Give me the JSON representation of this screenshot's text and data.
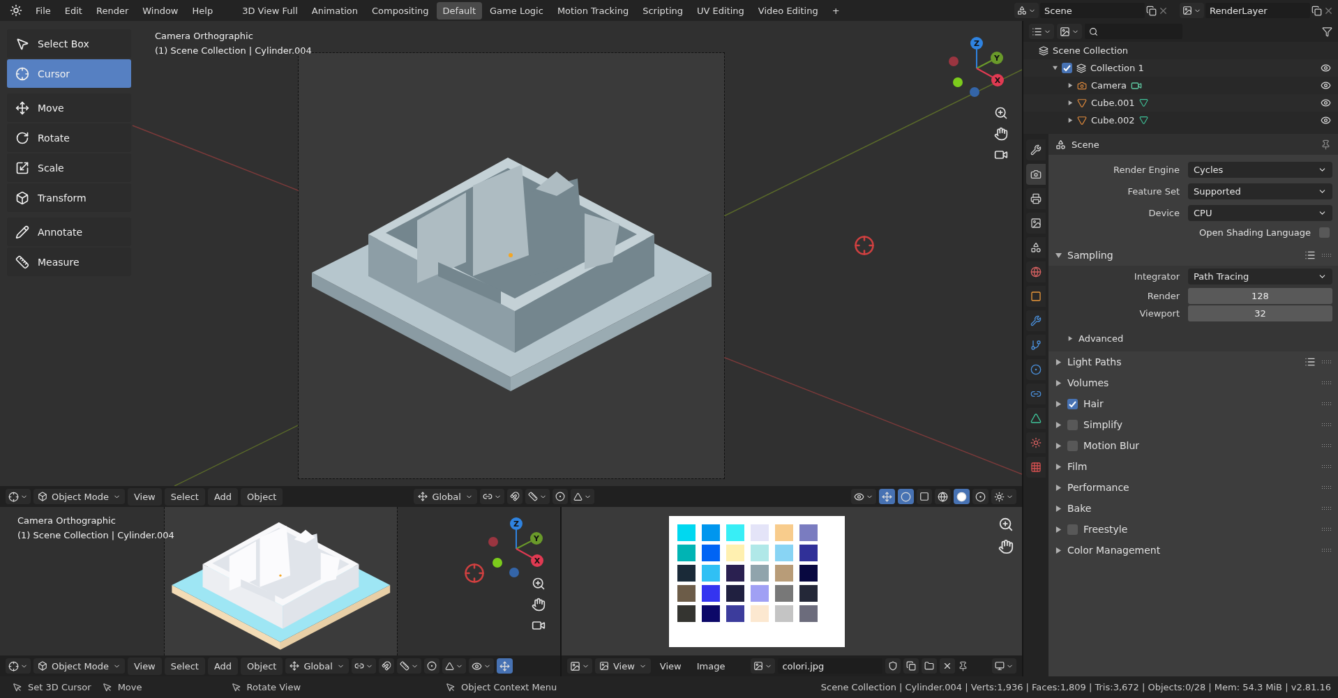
{
  "menu": [
    "File",
    "Edit",
    "Render",
    "Window",
    "Help"
  ],
  "workspaces": [
    {
      "label": "3D View Full",
      "selected": false
    },
    {
      "label": "Animation",
      "selected": false
    },
    {
      "label": "Compositing",
      "selected": false
    },
    {
      "label": "Default",
      "selected": true
    },
    {
      "label": "Game Logic",
      "selected": false
    },
    {
      "label": "Motion Tracking",
      "selected": false
    },
    {
      "label": "Scripting",
      "selected": false
    },
    {
      "label": "UV Editing",
      "selected": false
    },
    {
      "label": "Video Editing",
      "selected": false
    }
  ],
  "add_workspace": "+",
  "scene": "Scene",
  "view_layer": "RenderLayer",
  "main_viewport": {
    "overlay": [
      "Camera Orthographic",
      "(1) Scene Collection | Cylinder.004"
    ],
    "tools": [
      {
        "label": "Select Box",
        "selected": false
      },
      {
        "label": "Cursor",
        "selected": true
      },
      {
        "label": "Move",
        "selected": false
      },
      {
        "label": "Rotate",
        "selected": false
      },
      {
        "label": "Scale",
        "selected": false
      },
      {
        "label": "Transform",
        "selected": false
      },
      {
        "label": "Annotate",
        "selected": false
      },
      {
        "label": "Measure",
        "selected": false
      }
    ],
    "gizmo": [
      "Z",
      "Y",
      "X"
    ],
    "header": {
      "mode": "Object Mode",
      "menus": [
        "View",
        "Select",
        "Add",
        "Object"
      ],
      "orientation": "Global"
    }
  },
  "bottom_viewport": {
    "overlay": [
      "Camera Orthographic",
      "(1) Scene Collection | Cylinder.004"
    ],
    "gizmo": [
      "Z",
      "Y",
      "X"
    ],
    "header": {
      "mode": "Object Mode",
      "menus": [
        "View",
        "Select",
        "Add",
        "Object"
      ],
      "orientation": "Global"
    }
  },
  "image_editor": {
    "view_mode": "View",
    "menus": [
      "View",
      "Image"
    ],
    "image": "colori.jpg"
  },
  "outliner": {
    "root": "Scene Collection",
    "items": [
      {
        "label": "Collection 1",
        "kind": "collection",
        "checked": true,
        "expanded": true,
        "children": [
          {
            "label": "Camera",
            "kind": "camera",
            "expanded": false
          },
          {
            "label": "Cube.001",
            "kind": "mesh",
            "expanded": false
          },
          {
            "label": "Cube.002",
            "kind": "mesh",
            "expanded": false
          }
        ]
      }
    ]
  },
  "properties": {
    "tabs": [
      {
        "selected": false
      },
      {
        "selected": true
      },
      {
        "selected": false
      },
      {
        "selected": false
      },
      {
        "selected": false
      },
      {
        "selected": false
      },
      {
        "selected": false
      },
      {
        "selected": false
      },
      {
        "selected": false
      },
      {
        "selected": false
      },
      {
        "selected": false
      },
      {
        "selected": false
      },
      {
        "selected": false
      },
      {
        "selected": false
      }
    ],
    "title": "Scene",
    "rows": [
      {
        "kind": "dropdown",
        "label": "Render Engine",
        "value": "Cycles"
      },
      {
        "kind": "dropdown",
        "label": "Feature Set",
        "value": "Supported"
      },
      {
        "kind": "dropdown",
        "label": "Device",
        "value": "CPU"
      },
      {
        "kind": "checkbox",
        "label": "Open Shading Language",
        "checked": false
      }
    ],
    "panels": [
      {
        "label": "Sampling",
        "expanded": true,
        "presets": true,
        "rows": [
          {
            "kind": "dropdown",
            "label": "Integrator",
            "value": "Path Tracing"
          },
          {
            "kind": "number",
            "label": "Render",
            "value": "128"
          },
          {
            "kind": "number",
            "label": "Viewport",
            "value": "32"
          }
        ],
        "subpanels": [
          {
            "label": "Advanced",
            "expanded": false
          }
        ]
      },
      {
        "label": "Light Paths",
        "expanded": false,
        "presets": true
      },
      {
        "label": "Volumes",
        "expanded": false
      },
      {
        "label": "Hair",
        "expanded": false,
        "checked": true
      },
      {
        "label": "Simplify",
        "expanded": false,
        "checked": false
      },
      {
        "label": "Motion Blur",
        "expanded": false,
        "checked": false
      },
      {
        "label": "Film",
        "expanded": false
      },
      {
        "label": "Performance",
        "expanded": false
      },
      {
        "label": "Bake",
        "expanded": false
      },
      {
        "label": "Freestyle",
        "expanded": false,
        "checked": false
      },
      {
        "label": "Color Management",
        "expanded": false
      }
    ]
  },
  "status_bar": {
    "hints": [
      "Set 3D Cursor",
      "Move",
      "Rotate View",
      "Object Context Menu"
    ],
    "stats": "Scene Collection | Cylinder.004 | Verts:1,936 | Faces:1,809 | Tris:3,672 | Objects:0/28 | Mem: 54.3 MiB | v2.81.16"
  }
}
